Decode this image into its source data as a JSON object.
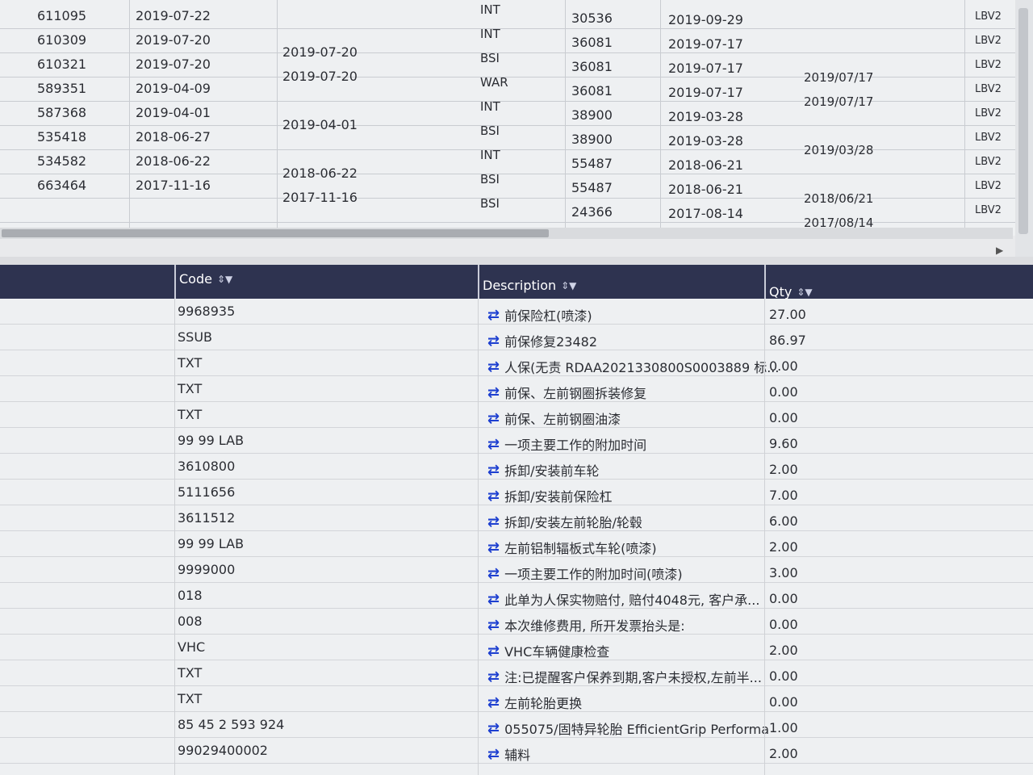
{
  "top_table": {
    "rows": [
      {
        "id": "611095",
        "date1": "2019-07-22",
        "date2": "",
        "type": "INT",
        "num": "30536",
        "date3": "2019-09-29",
        "date4": "",
        "vin": "LBV2"
      },
      {
        "id": "610309",
        "date1": "2019-07-20",
        "date2": "2019-07-20",
        "type": "INT",
        "num": "36081",
        "date3": "2019-07-17",
        "date4": "",
        "vin": "LBV2"
      },
      {
        "id": "610321",
        "date1": "2019-07-20",
        "date2": "2019-07-20",
        "type": "BSI",
        "num": "36081",
        "date3": "2019-07-17",
        "date4": "2019/07/17",
        "vin": "LBV2"
      },
      {
        "id": "589351",
        "date1": "2019-04-09",
        "date2": "",
        "type": "WAR",
        "num": "36081",
        "date3": "2019-07-17",
        "date4": "2019/07/17",
        "vin": "LBV2"
      },
      {
        "id": "587368",
        "date1": "2019-04-01",
        "date2": "2019-04-01",
        "type": "INT",
        "num": "38900",
        "date3": "2019-03-28",
        "date4": "",
        "vin": "LBV2"
      },
      {
        "id": "535418",
        "date1": "2018-06-27",
        "date2": "",
        "type": "BSI",
        "num": "38900",
        "date3": "2019-03-28",
        "date4": "2019/03/28",
        "vin": "LBV2"
      },
      {
        "id": "534582",
        "date1": "2018-06-22",
        "date2": "2018-06-22",
        "type": "INT",
        "num": "55487",
        "date3": "2018-06-21",
        "date4": "",
        "vin": "LBV2"
      },
      {
        "id": "663464",
        "date1": "2017-11-16",
        "date2": "2017-11-16",
        "type": "BSI",
        "num": "55487",
        "date3": "2018-06-21",
        "date4": "2018/06/21",
        "vin": "LBV2"
      },
      {
        "id": "",
        "date1": "",
        "date2": "",
        "type": "BSI",
        "num": "24366",
        "date3": "2017-08-14",
        "date4": "2017/08/14",
        "vin": "LBV2"
      }
    ]
  },
  "bottom_table": {
    "headers": {
      "code": "Code",
      "description": "Description",
      "qty": "Qty"
    },
    "rows": [
      {
        "code": "9968935",
        "description": "前保险杠(喷漆)",
        "qty": "27.00"
      },
      {
        "code": "SSUB",
        "description": "前保修复23482",
        "qty": "86.97"
      },
      {
        "code": "TXT",
        "description": "人保(无责 RDAA2021330800S0003889 标...",
        "qty": "0.00"
      },
      {
        "code": "TXT",
        "description": "前保、左前钢圈拆装修复",
        "qty": "0.00"
      },
      {
        "code": "TXT",
        "description": "前保、左前钢圈油漆",
        "qty": "0.00"
      },
      {
        "code": "99 99 LAB",
        "description": "一项主要工作的附加时间",
        "qty": "9.60"
      },
      {
        "code": "3610800",
        "description": "拆卸/安装前车轮",
        "qty": "2.00"
      },
      {
        "code": "5111656",
        "description": "拆卸/安装前保险杠",
        "qty": "7.00"
      },
      {
        "code": "3611512",
        "description": "拆卸/安装左前轮胎/轮毂",
        "qty": "6.00"
      },
      {
        "code": "99 99 LAB",
        "description": "左前铝制辐板式车轮(喷漆)",
        "qty": "2.00"
      },
      {
        "code": "9999000",
        "description": "一项主要工作的附加时间(喷漆)",
        "qty": "3.00"
      },
      {
        "code": "018",
        "description": "此单为人保实物赔付, 赔付4048元, 客户承...",
        "qty": "0.00"
      },
      {
        "code": "008",
        "description": "本次维修费用, 所开发票抬头是:",
        "qty": "0.00"
      },
      {
        "code": "VHC",
        "description": "VHC车辆健康检查",
        "qty": "2.00"
      },
      {
        "code": "TXT",
        "description": "注:已提醒客户保养到期,客户未授权,左前半...",
        "qty": "0.00"
      },
      {
        "code": "TXT",
        "description": "左前轮胎更换",
        "qty": "0.00"
      },
      {
        "code": "85 45 2 593 924",
        "description": "055075/固特异轮胎 EfficientGrip Performa",
        "qty": "1.00"
      },
      {
        "code": "99029400002",
        "description": "辅料",
        "qty": "2.00"
      }
    ]
  },
  "icons": {
    "sort": "sort-filter-icon",
    "swap": "swap-arrows-icon"
  },
  "colors": {
    "header_bg": "#2e3350",
    "swap_icon": "#1d3fd0"
  }
}
